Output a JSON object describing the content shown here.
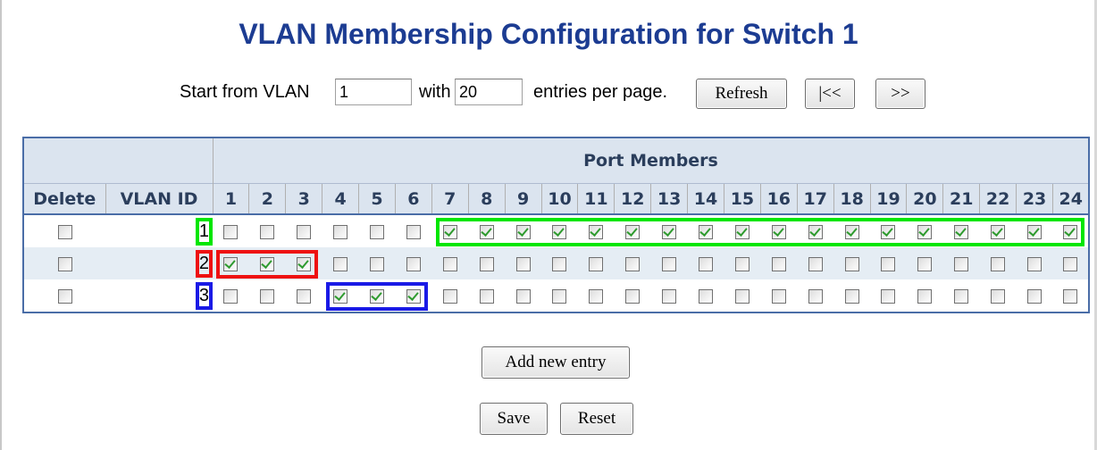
{
  "title": "VLAN Membership Configuration for Switch 1",
  "pager": {
    "start_label": "Start from VLAN",
    "start_value": "1",
    "with_label": "with",
    "with_value": "20",
    "entries_label": "entries per page.",
    "refresh_label": "Refresh",
    "prev_label": "|<<",
    "next_label": ">>"
  },
  "table": {
    "port_members_label": "Port Members",
    "delete_label": "Delete",
    "vlan_id_label": "VLAN ID",
    "ports": [
      "1",
      "2",
      "3",
      "4",
      "5",
      "6",
      "7",
      "8",
      "9",
      "10",
      "11",
      "12",
      "13",
      "14",
      "15",
      "16",
      "17",
      "18",
      "19",
      "20",
      "21",
      "22",
      "23",
      "24"
    ],
    "rows": [
      {
        "vlan_id": "1",
        "delete": false,
        "members": [
          false,
          false,
          false,
          false,
          false,
          false,
          true,
          true,
          true,
          true,
          true,
          true,
          true,
          true,
          true,
          true,
          true,
          true,
          true,
          true,
          true,
          true,
          true,
          true
        ]
      },
      {
        "vlan_id": "2",
        "delete": false,
        "members": [
          true,
          true,
          true,
          false,
          false,
          false,
          false,
          false,
          false,
          false,
          false,
          false,
          false,
          false,
          false,
          false,
          false,
          false,
          false,
          false,
          false,
          false,
          false,
          false
        ]
      },
      {
        "vlan_id": "3",
        "delete": false,
        "members": [
          false,
          false,
          false,
          true,
          true,
          true,
          false,
          false,
          false,
          false,
          false,
          false,
          false,
          false,
          false,
          false,
          false,
          false,
          false,
          false,
          false,
          false,
          false,
          false
        ]
      }
    ]
  },
  "highlight_colors": {
    "vlan1": "#00e600",
    "vlan2": "#ee1111",
    "vlan3": "#1a1ae6"
  },
  "add_entry_label": "Add new entry",
  "save_label": "Save",
  "reset_label": "Reset"
}
